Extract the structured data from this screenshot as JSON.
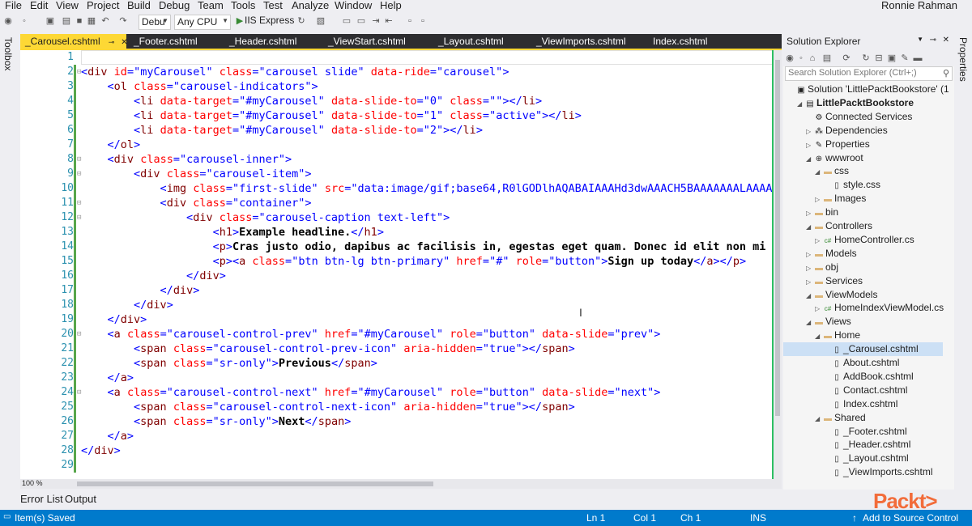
{
  "menu": [
    "File",
    "Edit",
    "View",
    "Project",
    "Build",
    "Debug",
    "Team",
    "Tools",
    "Test",
    "Analyze",
    "Window",
    "Help"
  ],
  "user": "Ronnie Rahman",
  "toolbar": {
    "config": "Debu",
    "platform": "Any CPU",
    "run_target": "IIS Express"
  },
  "side_left": "Toolbox",
  "side_right": "Properties",
  "tabs": [
    "_Carousel.cshtml",
    "_Footer.cshtml",
    "_Header.cshtml",
    "_ViewStart.cshtml",
    "_Layout.cshtml",
    "_ViewImports.cshtml",
    "Index.cshtml"
  ],
  "line_numbers": [
    "1",
    "2",
    "3",
    "4",
    "5",
    "6",
    "7",
    "8",
    "9",
    "10",
    "11",
    "12",
    "13",
    "14",
    "15",
    "16",
    "17",
    "18",
    "19",
    "20",
    "21",
    "22",
    "23",
    "24",
    "25",
    "26",
    "27",
    "28",
    "29"
  ],
  "code": [
    "",
    "<div id=\"myCarousel\" class=\"carousel slide\" data-ride=\"carousel\">",
    "    <ol class=\"carousel-indicators\">",
    "        <li data-target=\"#myCarousel\" data-slide-to=\"0\" class=\"\"></li>",
    "        <li data-target=\"#myCarousel\" data-slide-to=\"1\" class=\"active\"></li>",
    "        <li data-target=\"#myCarousel\" data-slide-to=\"2\"></li>",
    "    </ol>",
    "    <div class=\"carousel-inner\">",
    "        <div class=\"carousel-item\">",
    "            <img class=\"first-slide\" src=\"data:image/gif;base64,R0lGODlhAQABAIAAAHd3dwAAACH5BAAAAAAALAAAA",
    "            <div class=\"container\">",
    "                <div class=\"carousel-caption text-left\">",
    "                    <h1>Example headline.</h1>",
    "                    <p>Cras justo odio, dapibus ac facilisis in, egestas eget quam. Donec id elit non mi",
    "                    <p><a class=\"btn btn-lg btn-primary\" href=\"#\" role=\"button\">Sign up today</a></p>",
    "                </div>",
    "            </div>",
    "        </div>",
    "    </div>",
    "    <a class=\"carousel-control-prev\" href=\"#myCarousel\" role=\"button\" data-slide=\"prev\">",
    "        <span class=\"carousel-control-prev-icon\" aria-hidden=\"true\"></span>",
    "        <span class=\"sr-only\">Previous</span>",
    "    </a>",
    "    <a class=\"carousel-control-next\" href=\"#myCarousel\" role=\"button\" data-slide=\"next\">",
    "        <span class=\"carousel-control-next-icon\" aria-hidden=\"true\"></span>",
    "        <span class=\"sr-only\">Next</span>",
    "    </a>",
    "</div>",
    ""
  ],
  "zoom": "100 %",
  "solution_explorer": {
    "title": "Solution Explorer",
    "search_placeholder": "Search Solution Explorer (Ctrl+;)",
    "items": [
      {
        "label": "Solution 'LittlePacktBookstore' (1",
        "icon": "solution-icon"
      },
      {
        "label": "LittlePacktBookstore",
        "icon": "project-icon"
      },
      {
        "label": "Connected Services",
        "icon": "connected-services-icon"
      },
      {
        "label": "Dependencies",
        "icon": "dependencies-icon"
      },
      {
        "label": "Properties",
        "icon": "wrench-icon"
      },
      {
        "label": "wwwroot",
        "icon": "globe-icon"
      },
      {
        "label": "css",
        "icon": "folder-icon"
      },
      {
        "label": "style.css",
        "icon": "file-icon"
      },
      {
        "label": "Images",
        "icon": "folder-icon"
      },
      {
        "label": "bin",
        "icon": "folder-icon"
      },
      {
        "label": "Controllers",
        "icon": "folder-icon"
      },
      {
        "label": "HomeController.cs",
        "icon": "csharp-icon"
      },
      {
        "label": "Models",
        "icon": "folder-icon"
      },
      {
        "label": "obj",
        "icon": "folder-icon"
      },
      {
        "label": "Services",
        "icon": "folder-icon"
      },
      {
        "label": "ViewModels",
        "icon": "folder-icon"
      },
      {
        "label": "HomeIndexViewModel.cs",
        "icon": "csharp-icon"
      },
      {
        "label": "Views",
        "icon": "folder-icon"
      },
      {
        "label": "Home",
        "icon": "folder-icon"
      },
      {
        "label": "_Carousel.cshtml",
        "icon": "file-icon"
      },
      {
        "label": "About.cshtml",
        "icon": "file-icon"
      },
      {
        "label": "AddBook.cshtml",
        "icon": "file-icon"
      },
      {
        "label": "Contact.cshtml",
        "icon": "file-icon"
      },
      {
        "label": "Index.cshtml",
        "icon": "file-icon"
      },
      {
        "label": "Shared",
        "icon": "folder-icon"
      },
      {
        "label": "_Footer.cshtml",
        "icon": "file-icon"
      },
      {
        "label": "_Header.cshtml",
        "icon": "file-icon"
      },
      {
        "label": "_Layout.cshtml",
        "icon": "file-icon"
      },
      {
        "label": "_ViewImports.cshtml",
        "icon": "file-icon"
      }
    ]
  },
  "bottom_tabs": [
    "Error List",
    "Output"
  ],
  "status": {
    "message": "Item(s) Saved",
    "ln": "Ln 1",
    "col": "Col 1",
    "ch": "Ch 1",
    "mode": "INS",
    "source_control": "Add to Source Control"
  },
  "logo_text": "Packt>",
  "colors": {
    "accent_tab": "#fdd835",
    "status_bar": "#007acc",
    "logo": "#f26c3a"
  }
}
